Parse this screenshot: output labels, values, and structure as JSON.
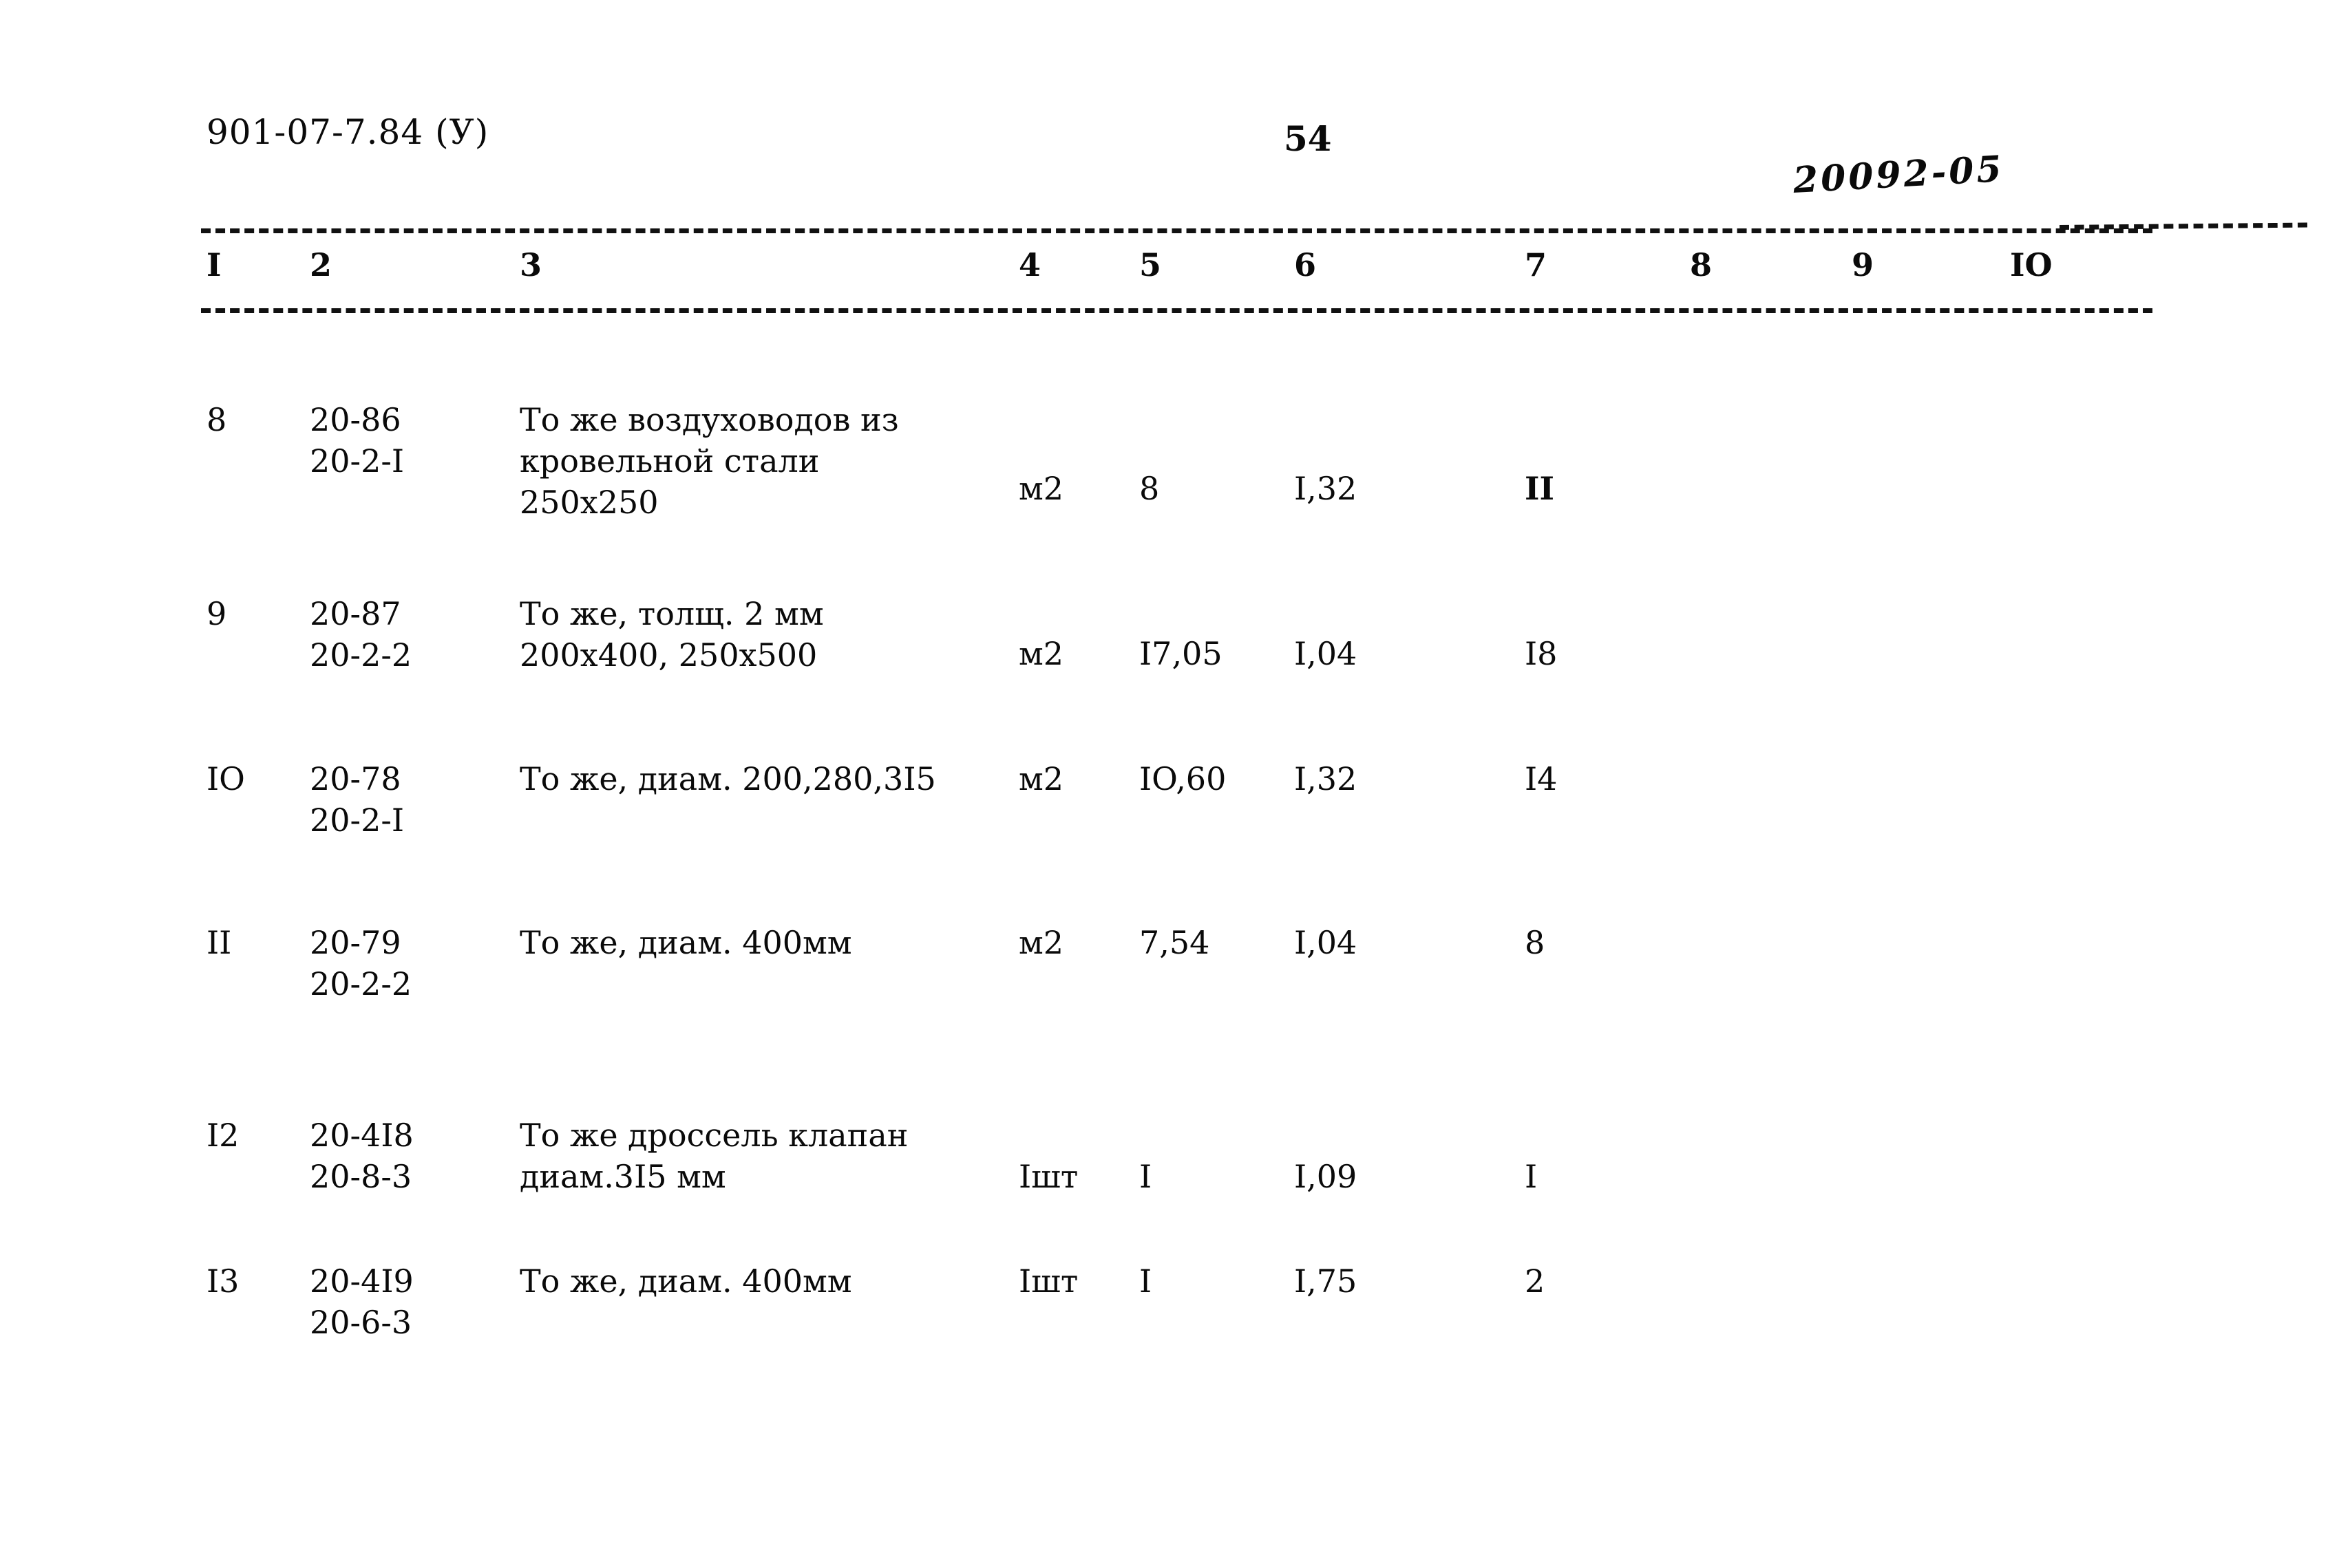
{
  "header": {
    "doc_code": "901-07-7.84 (У)",
    "page_number": "54",
    "handwritten_note": "20092-05"
  },
  "table": {
    "column_headers": [
      "I",
      "2",
      "3",
      "4",
      "5",
      "6",
      "7",
      "8",
      "9",
      "IO"
    ],
    "rows": [
      {
        "num": "8",
        "code": "20-86\n20-2-I",
        "description": "То же воздуховодов из\nкровельной стали\n250х250",
        "unit": "м2",
        "qty": "8",
        "coef": "I,32",
        "total": "II",
        "total_bold": true
      },
      {
        "num": "9",
        "code": "20-87\n20-2-2",
        "description": "То же, толщ. 2 мм\n200х400, 250х500",
        "unit": "м2",
        "qty": "I7,05",
        "coef": "I,04",
        "total": "I8",
        "total_bold": false
      },
      {
        "num": "IO",
        "code": "20-78\n20-2-I",
        "description": "То же, диам. 200,280,3I5",
        "unit": "м2",
        "qty": "IO,60",
        "coef": "I,32",
        "total": "I4",
        "total_bold": false
      },
      {
        "num": "II",
        "code": "20-79\n20-2-2",
        "description": "То же, диам. 400мм",
        "unit": "м2",
        "qty": "7,54",
        "coef": "I,04",
        "total": "8",
        "total_bold": false
      },
      {
        "num": "I2",
        "code": "20-4I8\n20-8-3",
        "description": "То же дроссель клапан\nдиам.3I5 мм",
        "unit": "Iшт",
        "qty": "I",
        "coef": "I,09",
        "total": "I",
        "total_bold": false
      },
      {
        "num": "I3",
        "code": "20-4I9\n20-6-3",
        "description": "То же, диам. 400мм",
        "unit": "Iшт",
        "qty": "I",
        "coef": "I,75",
        "total": "2",
        "total_bold": false
      }
    ]
  }
}
